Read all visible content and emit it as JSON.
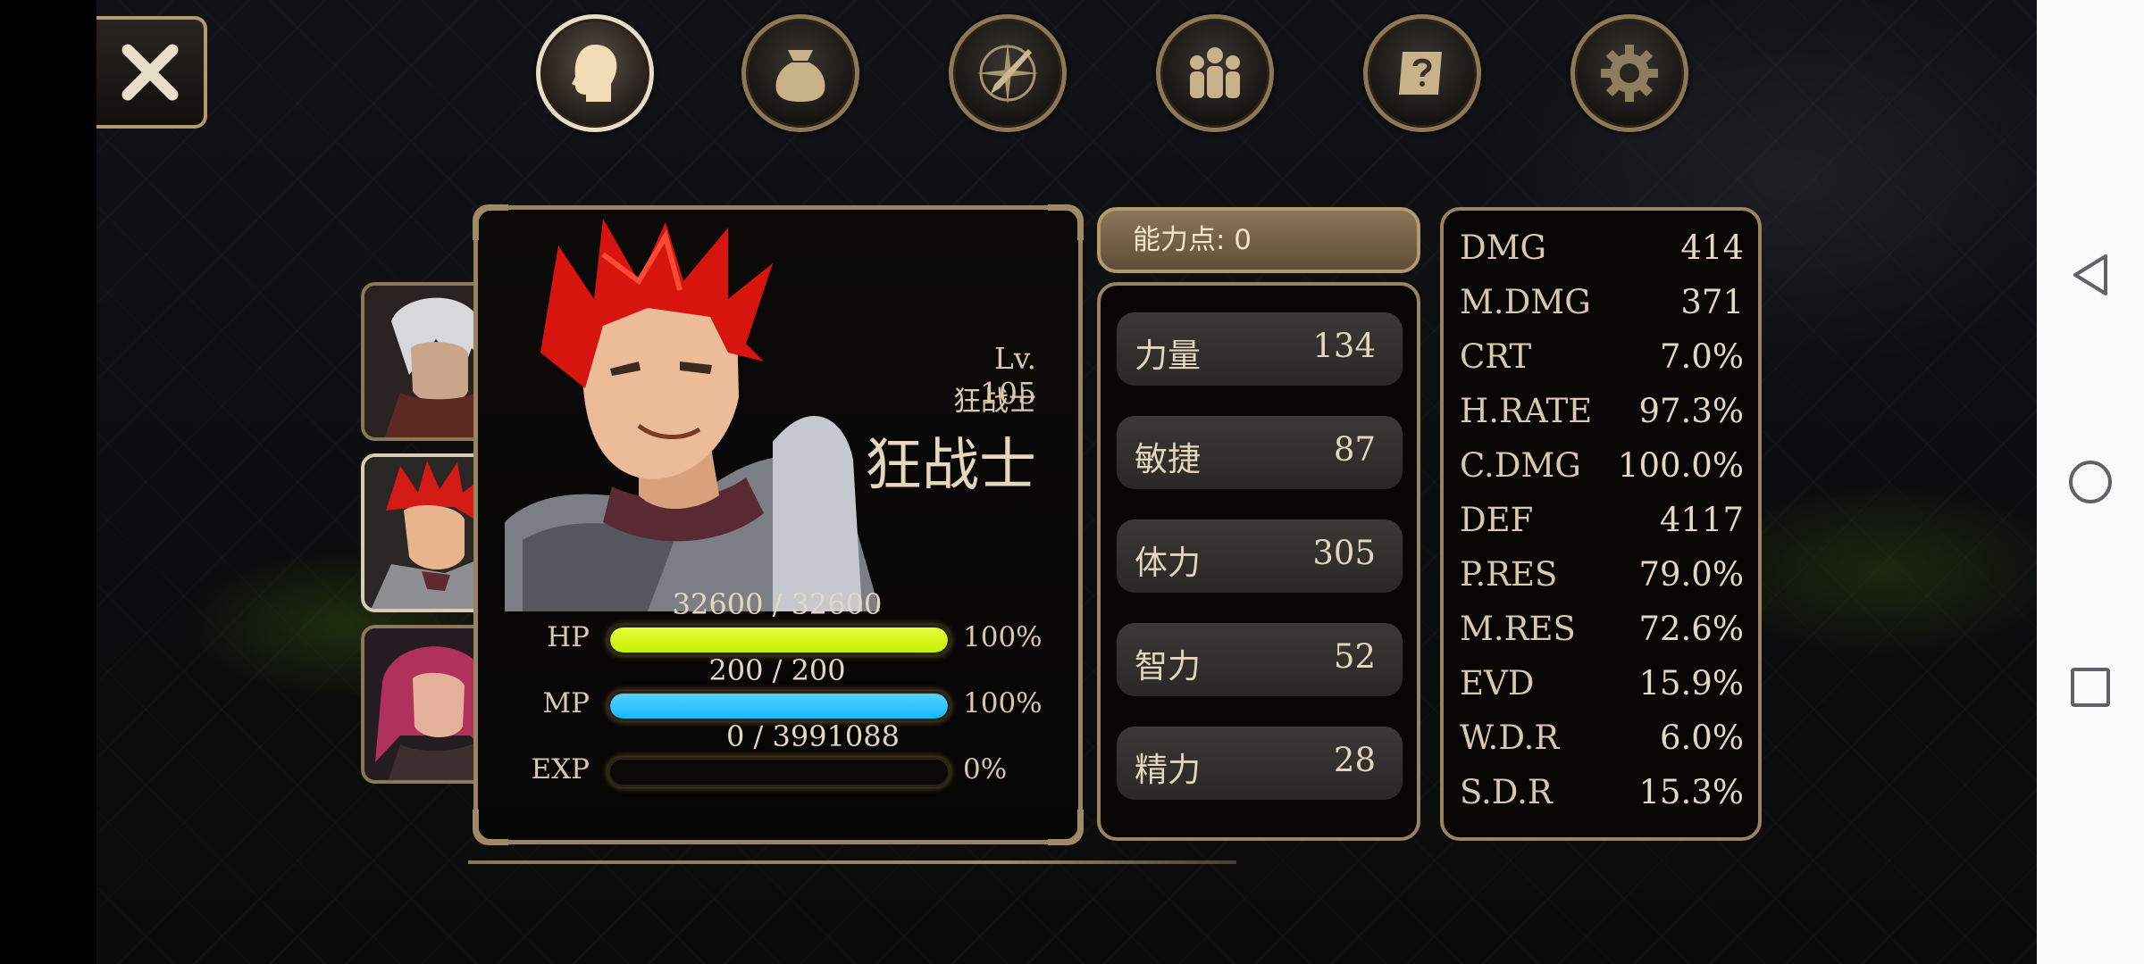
{
  "character": {
    "level": "Lv. 105",
    "class_small": "狂战士",
    "class_big": "狂战士",
    "hp": {
      "label": "HP",
      "value": "32600 / 32600",
      "percent_text": "100%",
      "fraction": 1.0
    },
    "mp": {
      "label": "MP",
      "value": "200 / 200",
      "percent_text": "100%",
      "fraction": 1.0
    },
    "exp": {
      "label": "EXP",
      "value": "0 / 3991088",
      "percent_text": "0%",
      "fraction": 0.0
    }
  },
  "ability_points": "能力点: 0",
  "attributes": [
    {
      "name": "力量",
      "value": "134"
    },
    {
      "name": "敏捷",
      "value": "87"
    },
    {
      "name": "体力",
      "value": "305"
    },
    {
      "name": "智力",
      "value": "52"
    },
    {
      "name": "精力",
      "value": "28"
    }
  ],
  "combat_stats": [
    {
      "name": "DMG",
      "value": "414"
    },
    {
      "name": "M.DMG",
      "value": "371"
    },
    {
      "name": "CRT",
      "value": "7.0%"
    },
    {
      "name": "H.RATE",
      "value": "97.3%"
    },
    {
      "name": "C.DMG",
      "value": "100.0%"
    },
    {
      "name": "DEF",
      "value": "4117"
    },
    {
      "name": "P.RES",
      "value": "79.0%"
    },
    {
      "name": "M.RES",
      "value": "72.6%"
    },
    {
      "name": "EVD",
      "value": "15.9%"
    },
    {
      "name": "W.D.R",
      "value": "6.0%"
    },
    {
      "name": "S.D.R",
      "value": "15.3%"
    }
  ],
  "menu_icons": [
    "character-icon",
    "bag-icon",
    "skills-icon",
    "party-icon",
    "quest-scroll-icon",
    "gear-icon"
  ],
  "party_members": [
    "white-haired-swordsman",
    "red-haired-berserker",
    "pink-haired-mage"
  ],
  "colors": {
    "hp": "#c7f000",
    "mp": "#18b7ff",
    "frame": "#9a8360",
    "accent": "#b39a6e"
  }
}
